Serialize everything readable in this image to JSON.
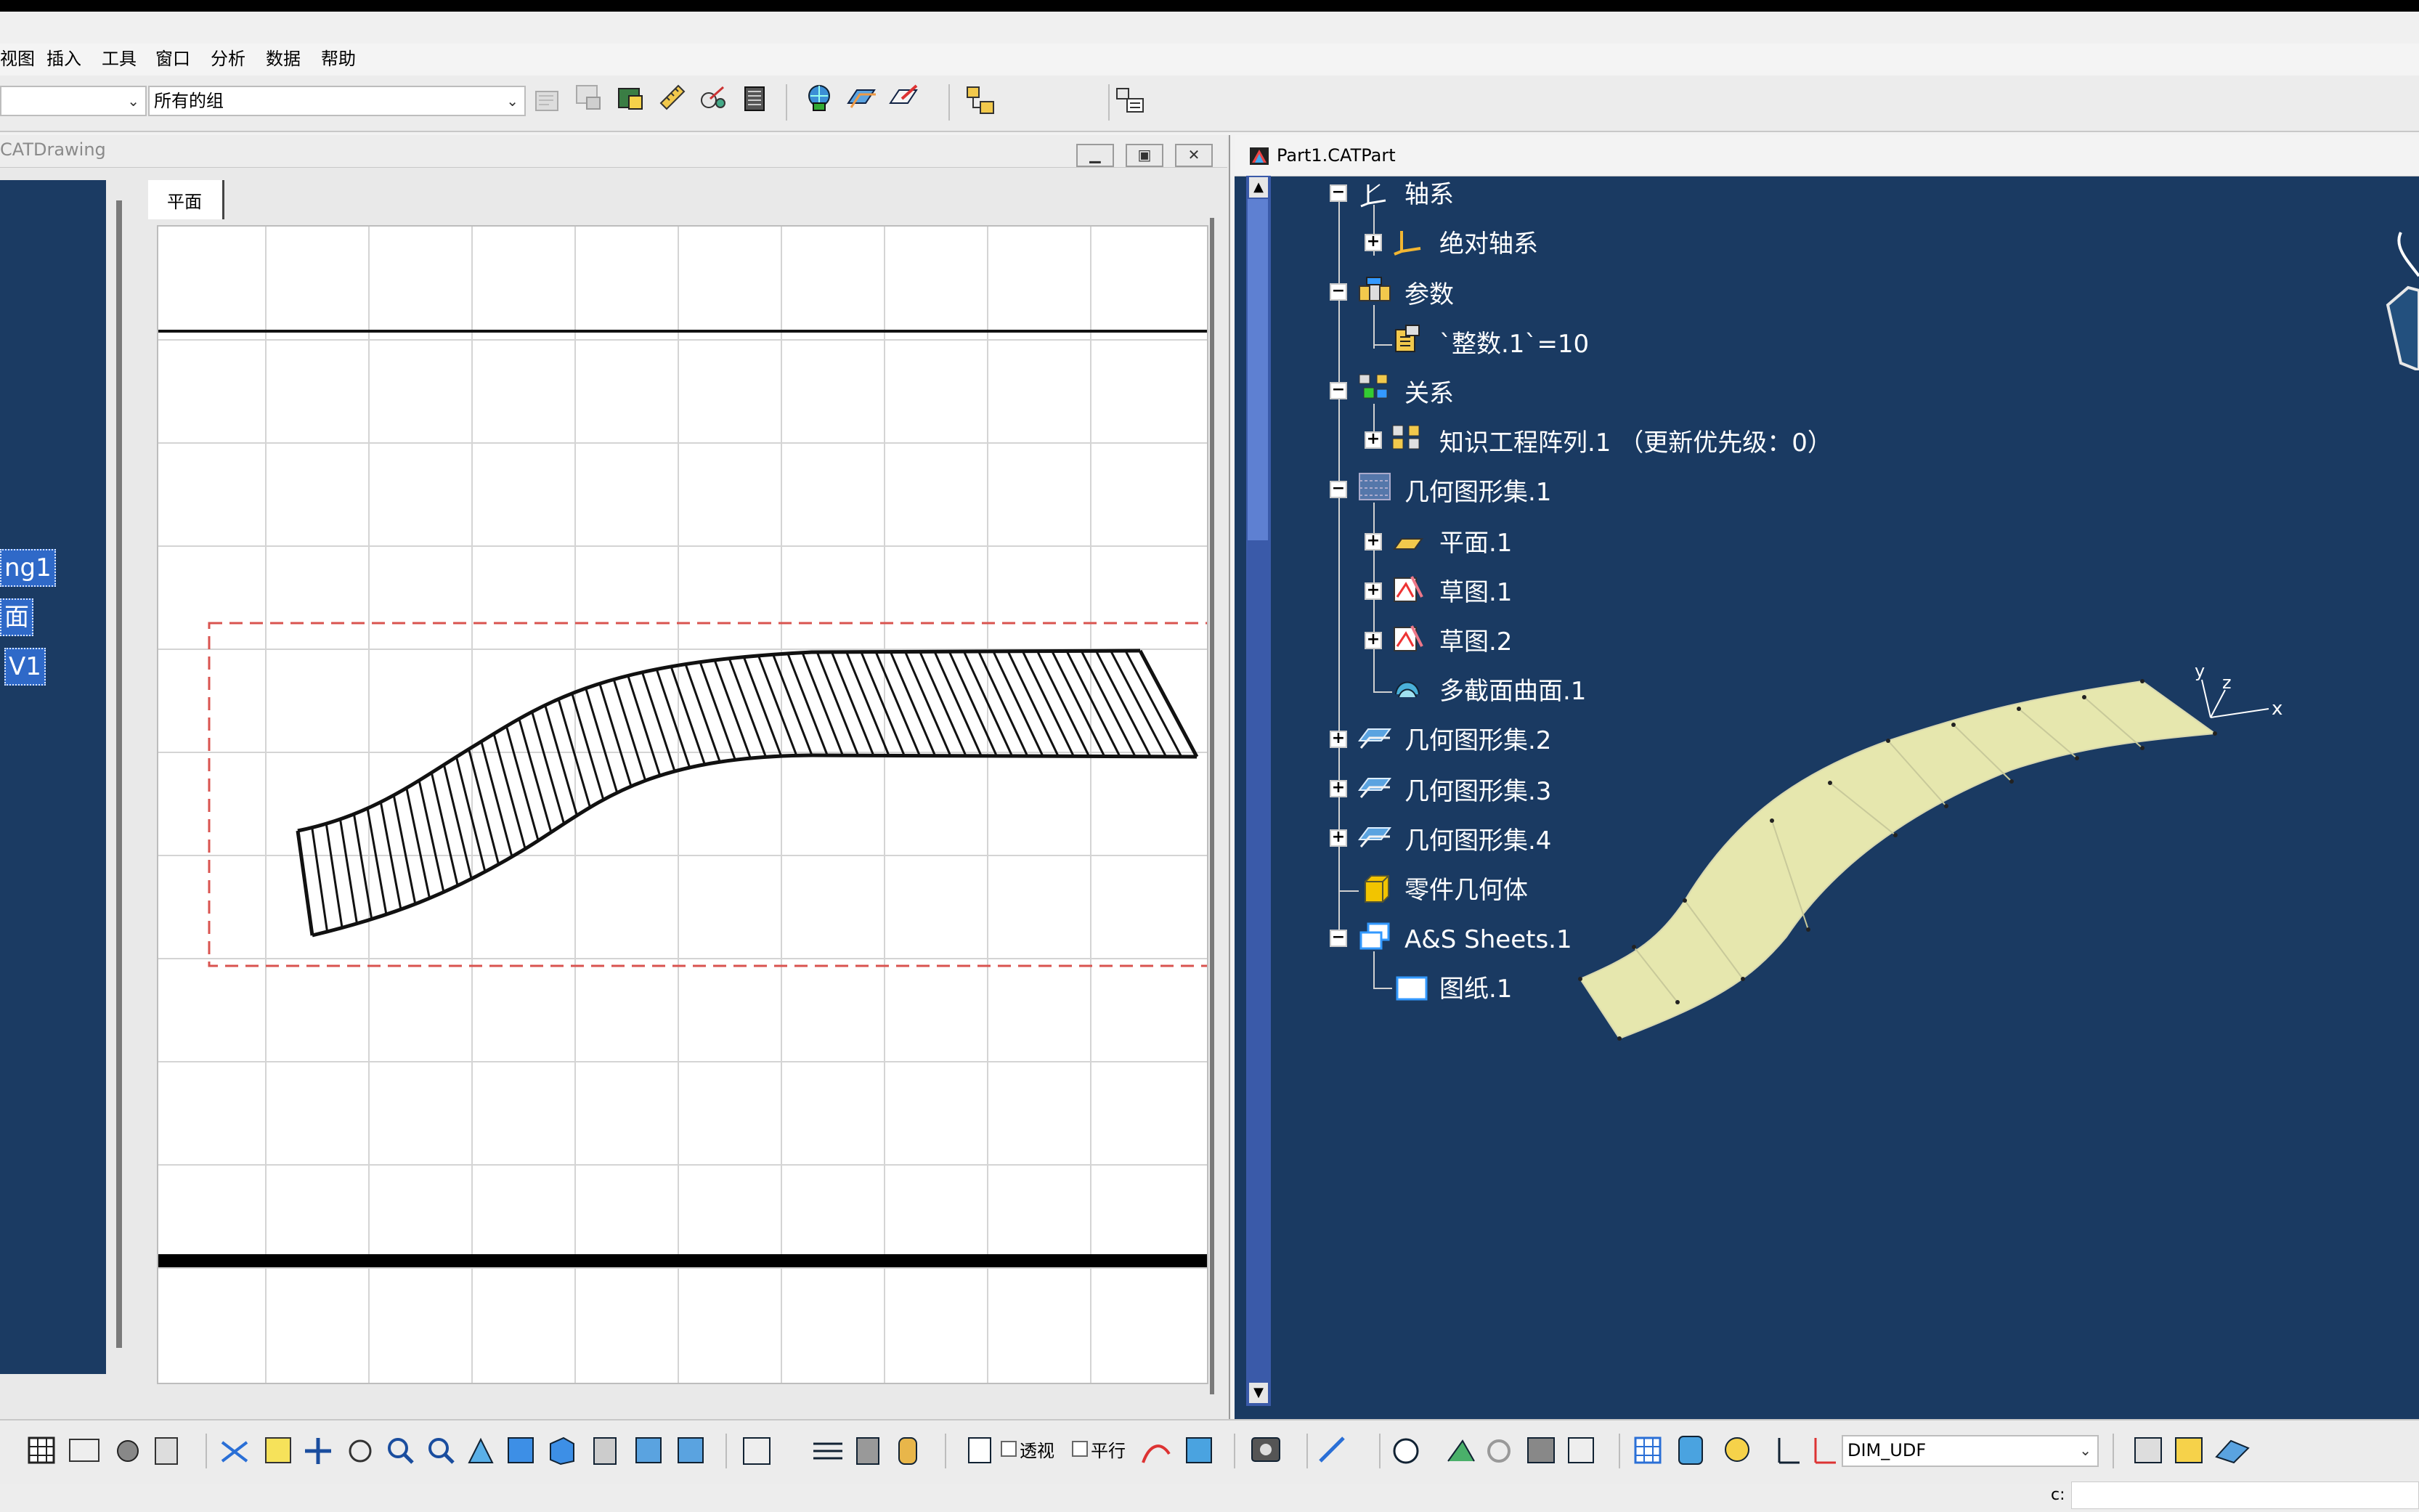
{
  "menu": {
    "items": [
      "视图",
      "插入",
      "工具",
      "窗口",
      "分析",
      "数据",
      "帮助"
    ]
  },
  "toolbar": {
    "group_combo_value": "所有的组"
  },
  "drawing_window": {
    "title": "CATDrawing",
    "sheet_tab": "平面",
    "left_tree_items": [
      "ng1",
      "面",
      "V1"
    ]
  },
  "part_window": {
    "title": "Part1.CATPart",
    "tree": [
      {
        "label": "轴系",
        "icon": "axis-system-icon"
      },
      {
        "label": "绝对轴系",
        "icon": "absolute-axis-icon"
      },
      {
        "label": "参数",
        "icon": "parameters-icon"
      },
      {
        "label": "`整数.1`=10",
        "icon": "integer-parameter-icon"
      },
      {
        "label": "关系",
        "icon": "relations-icon"
      },
      {
        "label": "知识工程阵列.1 （更新优先级：0）",
        "icon": "knowledge-pattern-icon"
      },
      {
        "label": "几何图形集.1",
        "icon": "geometrical-set-icon"
      },
      {
        "label": "平面.1",
        "icon": "plane-icon"
      },
      {
        "label": "草图.1",
        "icon": "sketch-icon"
      },
      {
        "label": "草图.2",
        "icon": "sketch-icon"
      },
      {
        "label": "多截面曲面.1",
        "icon": "multi-section-surface-icon"
      },
      {
        "label": "几何图形集.2",
        "icon": "geometrical-set-icon"
      },
      {
        "label": "几何图形集.3",
        "icon": "geometrical-set-icon"
      },
      {
        "label": "几何图形集.4",
        "icon": "geometrical-set-icon"
      },
      {
        "label": "零件几何体",
        "icon": "part-body-icon"
      },
      {
        "label": "A&S Sheets.1",
        "icon": "sheets-icon"
      },
      {
        "label": "图纸.1",
        "icon": "sheet-icon"
      }
    ],
    "axis_labels": {
      "x": "x",
      "y": "y",
      "z": "z"
    }
  },
  "bottom_toolbar": {
    "perspective_label": "透视",
    "parallel_label": "平行",
    "dim_combo_value": "DIM_UDF"
  },
  "status": {
    "prompt": "c:"
  },
  "colors": {
    "tree_background": "#1a3a62",
    "surface_fill": "#e6e7ae",
    "dashed_frame": "#d9534f",
    "selection": "#2f69c8"
  }
}
